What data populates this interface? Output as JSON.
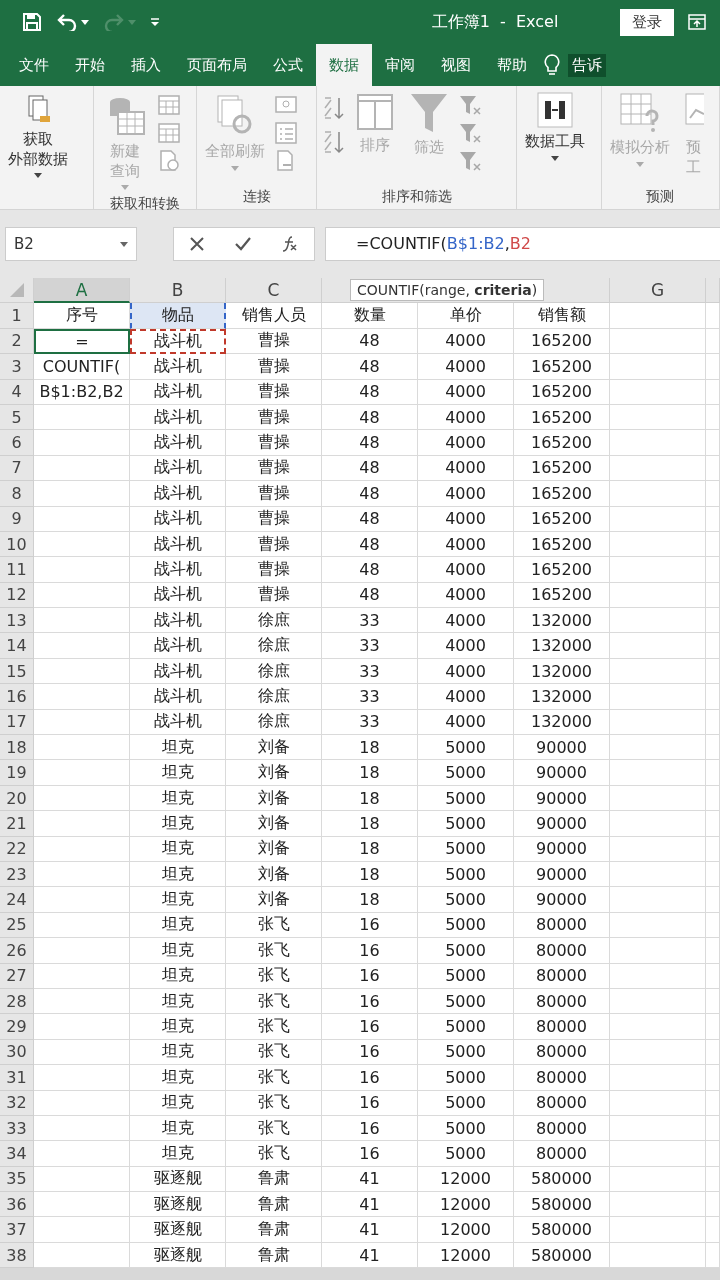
{
  "window": {
    "title": "工作簿1  -  Excel",
    "sign_in": "登录",
    "quick_access": {
      "redo_disabled": true
    }
  },
  "ribbon_tabs": [
    {
      "label": "文件",
      "selected": false
    },
    {
      "label": "开始",
      "selected": false
    },
    {
      "label": "插入",
      "selected": false
    },
    {
      "label": "页面布局",
      "selected": false
    },
    {
      "label": "公式",
      "selected": false
    },
    {
      "label": "数据",
      "selected": true
    },
    {
      "label": "审阅",
      "selected": false
    },
    {
      "label": "视图",
      "selected": false
    },
    {
      "label": "帮助",
      "selected": false
    }
  ],
  "tell_me": "告诉",
  "ribbon_groups": [
    {
      "buttons": [
        {
          "label_lines": [
            "获取",
            "外部数据"
          ],
          "disabled": false,
          "dropdown": true
        }
      ]
    },
    {
      "label": "获取和转换",
      "buttons": [
        {
          "label_lines": [
            "新建",
            "查询"
          ],
          "disabled": true,
          "dropdown": true
        }
      ]
    },
    {
      "label": "连接",
      "buttons": [
        {
          "label_lines": [
            "全部刷新"
          ],
          "disabled": true,
          "dropdown": true
        }
      ]
    },
    {
      "label": "排序和筛选",
      "buttons": [
        {
          "label_lines": [
            "排序"
          ],
          "disabled": true,
          "dropdown": false
        },
        {
          "label_lines": [
            "筛选"
          ],
          "disabled": true,
          "dropdown": false
        }
      ]
    },
    {
      "buttons": [
        {
          "label_lines": [
            "数据工具"
          ],
          "disabled": false,
          "dropdown": true
        }
      ]
    },
    {
      "label": "预测",
      "buttons": [
        {
          "label_lines": [
            "模拟分析"
          ],
          "disabled": true,
          "dropdown": true
        },
        {
          "label_lines": [
            "预",
            "工"
          ],
          "disabled": true,
          "dropdown": false
        }
      ]
    }
  ],
  "name_box": "B2",
  "formula": {
    "start": "=COUNTIF(",
    "range_ref": {
      "text": "B$1:B2",
      "color": "#3465c8"
    },
    "separator": ",",
    "criteria_ref": {
      "text": "B2",
      "color": "#d04a4a"
    }
  },
  "tooltip": "COUNTIF(range, **criteria**)",
  "column_headers": [
    {
      "label": "A",
      "selected": true
    },
    {
      "label": "B",
      "selected": false
    },
    {
      "label": "C",
      "selected": false
    },
    {
      "label": "G",
      "selected": false
    }
  ],
  "rows": [
    {
      "n": "1",
      "a": "序号",
      "b": "物品",
      "c": "销售人员",
      "d": "数量",
      "e": "单价",
      "f": "销售额",
      "editing": false,
      "range_ref": true,
      "criteria_ref": false
    },
    {
      "n": "2",
      "a": "=",
      "b": "战斗机",
      "c": "曹操",
      "d": "48",
      "e": "4000",
      "f": "165200",
      "editing": true,
      "range_ref": false,
      "criteria_ref": true
    },
    {
      "n": "3",
      "a": "COUNTIF(",
      "b": "战斗机",
      "c": "曹操",
      "d": "48",
      "e": "4000",
      "f": "165200",
      "editing": false,
      "range_ref": false,
      "criteria_ref": false
    },
    {
      "n": "4",
      "a": "B$1:B2,B2",
      "b": "战斗机",
      "c": "曹操",
      "d": "48",
      "e": "4000",
      "f": "165200",
      "editing": false,
      "range_ref": false,
      "criteria_ref": false
    },
    {
      "n": "5",
      "b": "战斗机",
      "c": "曹操",
      "d": "48",
      "e": "4000",
      "f": "165200",
      "editing": false,
      "range_ref": false,
      "criteria_ref": false
    },
    {
      "n": "6",
      "b": "战斗机",
      "c": "曹操",
      "d": "48",
      "e": "4000",
      "f": "165200",
      "editing": false,
      "range_ref": false,
      "criteria_ref": false
    },
    {
      "n": "7",
      "b": "战斗机",
      "c": "曹操",
      "d": "48",
      "e": "4000",
      "f": "165200",
      "editing": false,
      "range_ref": false,
      "criteria_ref": false
    },
    {
      "n": "8",
      "b": "战斗机",
      "c": "曹操",
      "d": "48",
      "e": "4000",
      "f": "165200",
      "editing": false,
      "range_ref": false,
      "criteria_ref": false
    },
    {
      "n": "9",
      "b": "战斗机",
      "c": "曹操",
      "d": "48",
      "e": "4000",
      "f": "165200",
      "editing": false,
      "range_ref": false,
      "criteria_ref": false
    },
    {
      "n": "10",
      "b": "战斗机",
      "c": "曹操",
      "d": "48",
      "e": "4000",
      "f": "165200",
      "editing": false,
      "range_ref": false,
      "criteria_ref": false
    },
    {
      "n": "11",
      "b": "战斗机",
      "c": "曹操",
      "d": "48",
      "e": "4000",
      "f": "165200",
      "editing": false,
      "range_ref": false,
      "criteria_ref": false
    },
    {
      "n": "12",
      "b": "战斗机",
      "c": "曹操",
      "d": "48",
      "e": "4000",
      "f": "165200",
      "editing": false,
      "range_ref": false,
      "criteria_ref": false
    },
    {
      "n": "13",
      "b": "战斗机",
      "c": "徐庶",
      "d": "33",
      "e": "4000",
      "f": "132000",
      "editing": false,
      "range_ref": false,
      "criteria_ref": false
    },
    {
      "n": "14",
      "b": "战斗机",
      "c": "徐庶",
      "d": "33",
      "e": "4000",
      "f": "132000",
      "editing": false,
      "range_ref": false,
      "criteria_ref": false
    },
    {
      "n": "15",
      "b": "战斗机",
      "c": "徐庶",
      "d": "33",
      "e": "4000",
      "f": "132000",
      "editing": false,
      "range_ref": false,
      "criteria_ref": false
    },
    {
      "n": "16",
      "b": "战斗机",
      "c": "徐庶",
      "d": "33",
      "e": "4000",
      "f": "132000",
      "editing": false,
      "range_ref": false,
      "criteria_ref": false
    },
    {
      "n": "17",
      "b": "战斗机",
      "c": "徐庶",
      "d": "33",
      "e": "4000",
      "f": "132000",
      "editing": false,
      "range_ref": false,
      "criteria_ref": false
    },
    {
      "n": "18",
      "b": "坦克",
      "c": "刘备",
      "d": "18",
      "e": "5000",
      "f": "90000",
      "editing": false,
      "range_ref": false,
      "criteria_ref": false
    },
    {
      "n": "19",
      "b": "坦克",
      "c": "刘备",
      "d": "18",
      "e": "5000",
      "f": "90000",
      "editing": false,
      "range_ref": false,
      "criteria_ref": false
    },
    {
      "n": "20",
      "b": "坦克",
      "c": "刘备",
      "d": "18",
      "e": "5000",
      "f": "90000",
      "editing": false,
      "range_ref": false,
      "criteria_ref": false
    },
    {
      "n": "21",
      "b": "坦克",
      "c": "刘备",
      "d": "18",
      "e": "5000",
      "f": "90000",
      "editing": false,
      "range_ref": false,
      "criteria_ref": false
    },
    {
      "n": "22",
      "b": "坦克",
      "c": "刘备",
      "d": "18",
      "e": "5000",
      "f": "90000",
      "editing": false,
      "range_ref": false,
      "criteria_ref": false
    },
    {
      "n": "23",
      "b": "坦克",
      "c": "刘备",
      "d": "18",
      "e": "5000",
      "f": "90000",
      "editing": false,
      "range_ref": false,
      "criteria_ref": false
    },
    {
      "n": "24",
      "b": "坦克",
      "c": "刘备",
      "d": "18",
      "e": "5000",
      "f": "90000",
      "editing": false,
      "range_ref": false,
      "criteria_ref": false
    },
    {
      "n": "25",
      "b": "坦克",
      "c": "张飞",
      "d": "16",
      "e": "5000",
      "f": "80000",
      "editing": false,
      "range_ref": false,
      "criteria_ref": false
    },
    {
      "n": "26",
      "b": "坦克",
      "c": "张飞",
      "d": "16",
      "e": "5000",
      "f": "80000",
      "editing": false,
      "range_ref": false,
      "criteria_ref": false
    },
    {
      "n": "27",
      "b": "坦克",
      "c": "张飞",
      "d": "16",
      "e": "5000",
      "f": "80000",
      "editing": false,
      "range_ref": false,
      "criteria_ref": false
    },
    {
      "n": "28",
      "b": "坦克",
      "c": "张飞",
      "d": "16",
      "e": "5000",
      "f": "80000",
      "editing": false,
      "range_ref": false,
      "criteria_ref": false
    },
    {
      "n": "29",
      "b": "坦克",
      "c": "张飞",
      "d": "16",
      "e": "5000",
      "f": "80000",
      "editing": false,
      "range_ref": false,
      "criteria_ref": false
    },
    {
      "n": "30",
      "b": "坦克",
      "c": "张飞",
      "d": "16",
      "e": "5000",
      "f": "80000",
      "editing": false,
      "range_ref": false,
      "criteria_ref": false
    },
    {
      "n": "31",
      "b": "坦克",
      "c": "张飞",
      "d": "16",
      "e": "5000",
      "f": "80000",
      "editing": false,
      "range_ref": false,
      "criteria_ref": false
    },
    {
      "n": "32",
      "b": "坦克",
      "c": "张飞",
      "d": "16",
      "e": "5000",
      "f": "80000",
      "editing": false,
      "range_ref": false,
      "criteria_ref": false
    },
    {
      "n": "33",
      "b": "坦克",
      "c": "张飞",
      "d": "16",
      "e": "5000",
      "f": "80000",
      "editing": false,
      "range_ref": false,
      "criteria_ref": false
    },
    {
      "n": "34",
      "b": "坦克",
      "c": "张飞",
      "d": "16",
      "e": "5000",
      "f": "80000",
      "editing": false,
      "range_ref": false,
      "criteria_ref": false
    },
    {
      "n": "35",
      "b": "驱逐舰",
      "c": "鲁肃",
      "d": "41",
      "e": "12000",
      "f": "580000",
      "editing": false,
      "range_ref": false,
      "criteria_ref": false
    },
    {
      "n": "36",
      "b": "驱逐舰",
      "c": "鲁肃",
      "d": "41",
      "e": "12000",
      "f": "580000",
      "editing": false,
      "range_ref": false,
      "criteria_ref": false
    },
    {
      "n": "37",
      "b": "驱逐舰",
      "c": "鲁肃",
      "d": "41",
      "e": "12000",
      "f": "580000",
      "editing": false,
      "range_ref": false,
      "criteria_ref": false
    },
    {
      "n": "38",
      "b": "驱逐舰",
      "c": "鲁肃",
      "d": "41",
      "e": "12000",
      "f": "580000",
      "editing": false,
      "range_ref": false,
      "criteria_ref": false
    }
  ]
}
